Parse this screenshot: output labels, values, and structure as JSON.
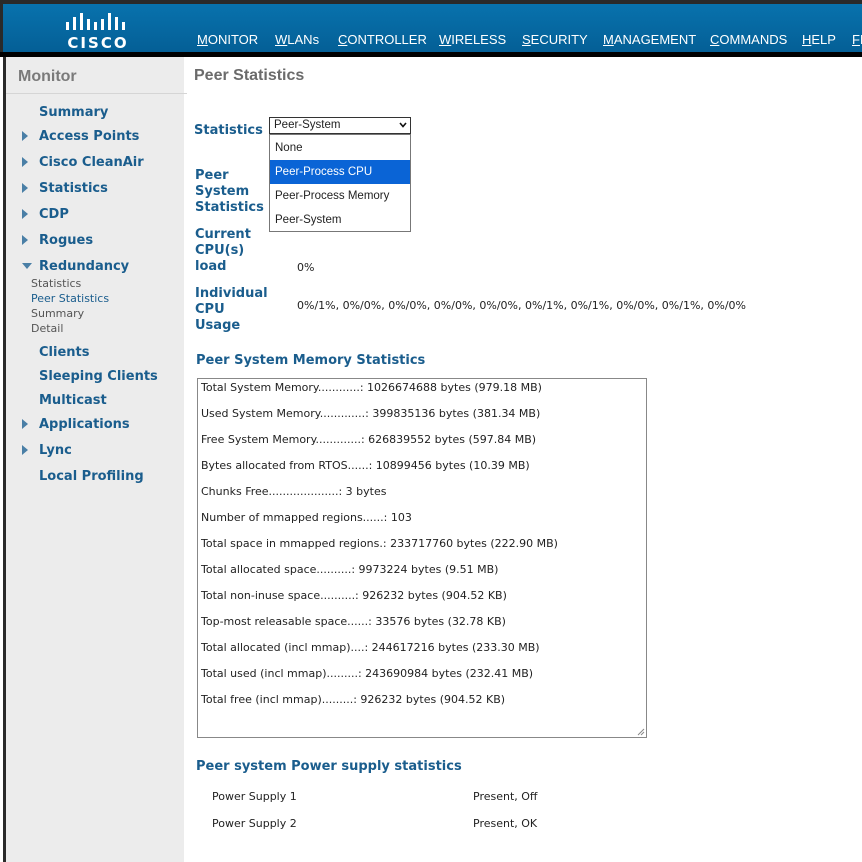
{
  "brand": {
    "logo_text": "CISCO"
  },
  "nav": [
    {
      "label": "MONITOR",
      "key": "M",
      "rest": "ONITOR"
    },
    {
      "label": "WLANs",
      "key": "W",
      "rest": "LANs"
    },
    {
      "label": "CONTROLLER",
      "key": "C",
      "rest": "ONTROLLER"
    },
    {
      "label": "WIRELESS",
      "key": "W",
      "rest": "IRELESS"
    },
    {
      "label": "SECURITY",
      "key": "S",
      "rest": "ECURITY"
    },
    {
      "label": "MANAGEMENT",
      "key": "M",
      "rest": "ANAGEMENT"
    },
    {
      "label": "COMMANDS",
      "key": "C",
      "rest": "OMMANDS"
    },
    {
      "label": "HELP",
      "key": "H",
      "rest": "ELP"
    },
    {
      "label": "FE",
      "key": "F",
      "rest": "E"
    }
  ],
  "sidebar": {
    "title": "Monitor",
    "items": [
      {
        "label": "Summary",
        "arrow": ""
      },
      {
        "label": "Access Points",
        "arrow": "right"
      },
      {
        "label": "Cisco CleanAir",
        "arrow": "right"
      },
      {
        "label": "Statistics",
        "arrow": "right"
      },
      {
        "label": "CDP",
        "arrow": "right"
      },
      {
        "label": "Rogues",
        "arrow": "right"
      },
      {
        "label": "Redundancy",
        "arrow": "down"
      },
      {
        "label": "Clients",
        "arrow": ""
      },
      {
        "label": "Sleeping Clients",
        "arrow": ""
      },
      {
        "label": "Multicast",
        "arrow": ""
      },
      {
        "label": "Applications",
        "arrow": "right"
      },
      {
        "label": "Lync",
        "arrow": "right"
      },
      {
        "label": "Local Profiling",
        "arrow": ""
      }
    ],
    "redundancy_sub": [
      "Statistics",
      "Peer Statistics",
      "Summary",
      "Detail"
    ]
  },
  "page": {
    "title": "Peer Statistics",
    "statistics_label": "Statistics",
    "select_value": "Peer-System",
    "dropdown_options": [
      "None",
      "Peer-Process CPU",
      "Peer-Process Memory",
      "Peer-System"
    ],
    "dropdown_highlighted": "Peer-Process CPU",
    "peer_system_statistics_label": [
      "Peer",
      "System",
      "Statistics"
    ],
    "current_cpu_label": [
      "Current",
      "CPU(s)",
      "load"
    ],
    "current_cpu_value": "0%",
    "individual_cpu_label": [
      "Individual",
      "CPU",
      "Usage"
    ],
    "individual_cpu_value": "0%/1%, 0%/0%, 0%/0%, 0%/0%, 0%/0%, 0%/1%, 0%/1%, 0%/0%, 0%/1%, 0%/0%",
    "memory_heading": "Peer System Memory Statistics",
    "memory_lines": [
      "Total System Memory............: 1026674688 bytes (979.18 MB)",
      "Used System Memory.............: 399835136 bytes (381.34 MB)",
      "Free System Memory.............: 626839552 bytes (597.84 MB)",
      "Bytes allocated from RTOS......: 10899456 bytes (10.39 MB)",
      "Chunks Free....................: 3 bytes",
      "Number of mmapped regions......: 103",
      "Total space in mmapped regions.: 233717760 bytes (222.90 MB)",
      "Total allocated space..........: 9973224 bytes (9.51 MB)",
      "Total non-inuse space..........: 926232 bytes (904.52 KB)",
      "Top-most releasable space......: 33576 bytes (32.78 KB)",
      "Total allocated (incl mmap)....: 244617216 bytes (233.30 MB)",
      "Total used (incl mmap).........: 243690984 bytes (232.41 MB)",
      "Total free (incl mmap).........: 926232 bytes (904.52 KB)"
    ],
    "power_heading": "Peer system Power supply statistics",
    "power_supplies": [
      {
        "label": "Power Supply 1",
        "status": "Present, Off"
      },
      {
        "label": "Power Supply 2",
        "status": "Present, OK"
      }
    ]
  },
  "colors": {
    "header": "#045f96",
    "link_blue": "#1a5d8d",
    "highlight": "#0a64d6",
    "sidebar_bg": "#ececec"
  }
}
